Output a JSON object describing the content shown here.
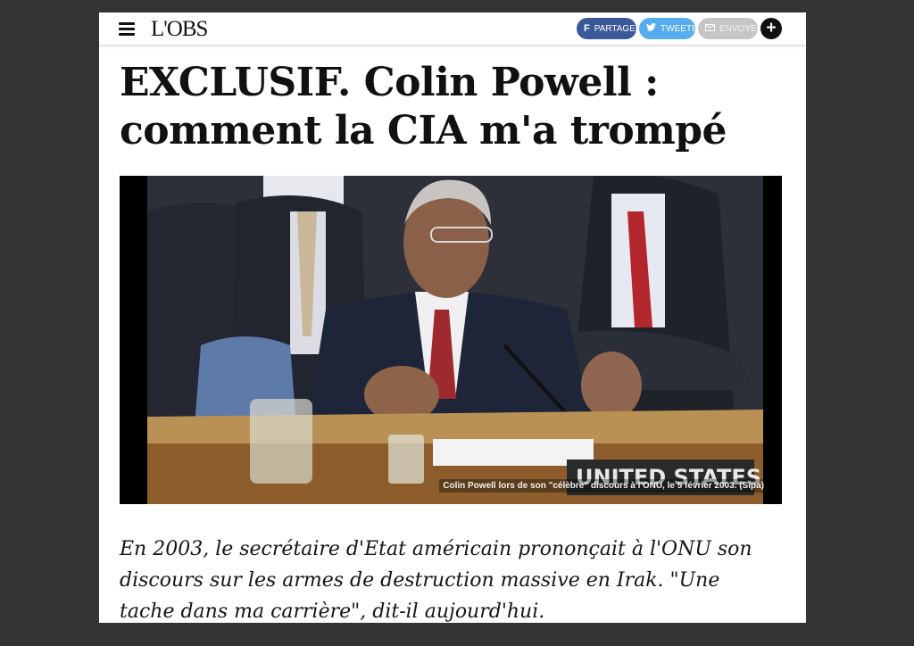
{
  "header": {
    "logo_text": "L'OBS",
    "share": {
      "facebook_label": "PARTAGER",
      "twitter_label": "TWEETER",
      "email_label": "ENVOYER"
    },
    "plus_symbol": "+"
  },
  "article": {
    "title": "EXCLUSIF. Colin Powell : comment la CIA m'a trompé",
    "image": {
      "caption": "Colin Powell lors de son \"célèbre\" discours à l'ONU, le 5 février 2003. (Sipa)",
      "placard_text": "UNITED STATES"
    },
    "lead": "En 2003, le secrétaire d'Etat américain prononçait à l'ONU son discours sur les armes de destruction massive en Irak. \"Une tache dans ma carrière\", dit-il aujourd'hui."
  },
  "icons": {
    "menu": "hamburger-icon",
    "facebook": "facebook-icon",
    "twitter": "twitter-icon",
    "email": "email-icon",
    "plus": "plus-icon"
  },
  "colors": {
    "backdrop": "#333333",
    "facebook": "#3b5998",
    "twitter": "#55acee",
    "email": "#c6c6c6",
    "plus": "#111111"
  }
}
